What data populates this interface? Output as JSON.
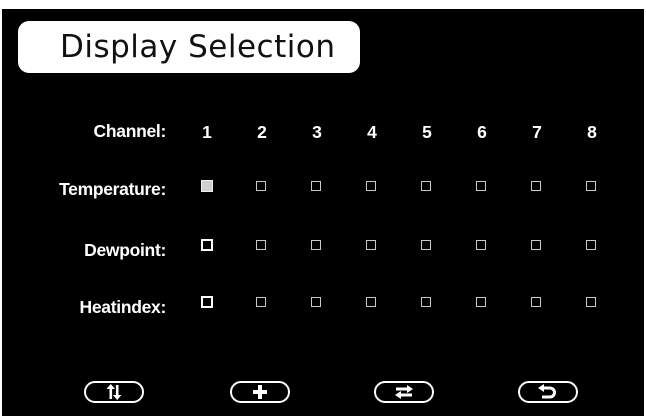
{
  "title": "Display Selection",
  "row_labels": {
    "channel": "Channel:",
    "temperature": "Temperature:",
    "dewpoint": "Dewpoint:",
    "heatindex": "Heatindex:"
  },
  "channels": [
    "1",
    "2",
    "3",
    "4",
    "5",
    "6",
    "7",
    "8"
  ],
  "selections": {
    "temperature": [
      true,
      false,
      false,
      false,
      false,
      false,
      false,
      false
    ],
    "dewpoint": [
      false,
      false,
      false,
      false,
      false,
      false,
      false,
      false
    ],
    "heatindex": [
      false,
      false,
      false,
      false,
      false,
      false,
      false,
      false
    ]
  },
  "buttons": [
    {
      "icon": "up-down-arrows-icon"
    },
    {
      "icon": "plus-icon"
    },
    {
      "icon": "swap-arrows-icon"
    },
    {
      "icon": "return-arrow-icon"
    }
  ],
  "colors": {
    "background": "#000000",
    "foreground": "#ffffff",
    "title_box": "#ffffff",
    "checked_fill": "#cfcfcf"
  }
}
